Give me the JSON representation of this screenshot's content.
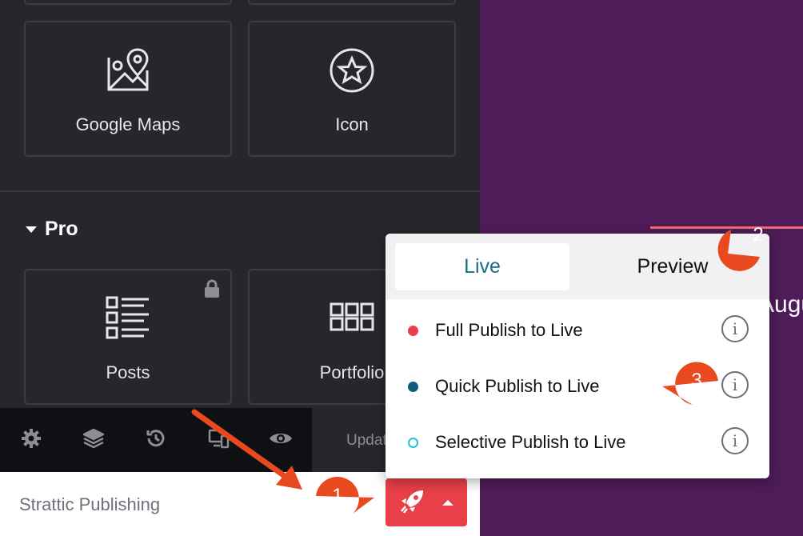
{
  "widgets": [
    {
      "label": "Google Maps",
      "icon": "map-icon"
    },
    {
      "label": "Icon",
      "icon": "star-icon"
    }
  ],
  "pro_section": {
    "title": "Pro",
    "widgets": [
      {
        "label": "Posts",
        "icon": "posts-icon",
        "locked": true
      },
      {
        "label": "Portfolio",
        "icon": "grid-icon"
      }
    ]
  },
  "toolbar": {
    "icons": [
      "gear-icon",
      "layers-icon",
      "history-icon",
      "responsive-icon",
      "eye-icon"
    ],
    "update_label": "Update"
  },
  "bottom_bar": {
    "label": "Strattic Publishing",
    "publish_button_icon": "rocket-icon"
  },
  "popup": {
    "tabs": [
      {
        "label": "Live",
        "active": true
      },
      {
        "label": "Preview",
        "active": false
      }
    ],
    "options": [
      {
        "label": "Full Publish to Live",
        "dot_color": "#e84049",
        "filled": true
      },
      {
        "label": "Quick Publish to Live",
        "dot_color": "#0f5f7c",
        "filled": true
      },
      {
        "label": "Selective Publish to Live",
        "dot_color": "#25c2d5",
        "filled": false
      }
    ],
    "info_glyph": "i"
  },
  "canvas": {
    "peek_text": "Augus",
    "background": "#4f1b58"
  },
  "annotations": [
    {
      "number": "1"
    },
    {
      "number": "2"
    },
    {
      "number": "3"
    }
  ],
  "colors": {
    "accent_red": "#e84049",
    "annotation_orange": "#e8491e",
    "live_tab_text": "#1e6a89"
  }
}
